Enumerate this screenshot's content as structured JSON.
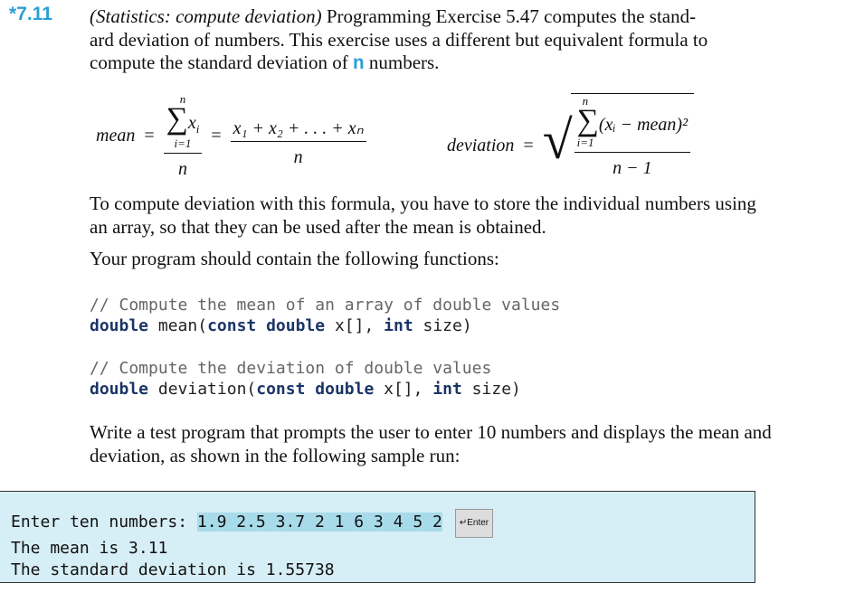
{
  "exercise": {
    "number": "*7.11",
    "title": "(Statistics: compute deviation)",
    "intro_1": " Programming Exercise 5.47 computes the stand-",
    "intro_2": "ard deviation of numbers. This exercise uses a different but equivalent formula to",
    "intro_3a": "compute the standard deviation of ",
    "intro_var": "n",
    "intro_3b": " numbers."
  },
  "formula": {
    "mean_label": "mean",
    "eq": "=",
    "sum_top": "n",
    "sum_sub": "i=1",
    "sum_term": "x",
    "sub_i": "i",
    "denominator": "n",
    "expanded": "x₁ + x₂ +  . . .  + xₙ",
    "deviation_label": "deviation",
    "dev_term": "(xᵢ − mean)²",
    "dev_denominator": "n − 1"
  },
  "para1": "To compute deviation with this formula, you have to store the individual numbers using an array, so that they can be used after the mean is obtained.",
  "para2": "Your program should contain the following functions:",
  "code": {
    "c1": "// Compute the mean of an array of double values",
    "f1_kw1": "double",
    "f1_a": " mean(",
    "f1_kw2": "const double",
    "f1_b": " x[], ",
    "f1_kw3": "int",
    "f1_c": " size)",
    "c2": "// Compute the deviation of double values",
    "f2_kw1": "double",
    "f2_a": " deviation(",
    "f2_kw2": "const double",
    "f2_b": " x[], ",
    "f2_kw3": "int",
    "f2_c": " size)"
  },
  "para3": "Write a test program that prompts the user to enter 10 numbers and displays the mean and deviation, as shown in the following sample run:",
  "sample_run": {
    "prompt": "Enter ten numbers: ",
    "input": "1.9 2.5 3.7 2 1 6 3 4 5 2",
    "enter_key": "↵Enter",
    "line2": "The mean is 3.11",
    "line3": "The standard deviation is 1.55738"
  },
  "colors": {
    "accent": "#2a9fd6",
    "run_bg": "#d6eef6",
    "input_highlight": "#a8dbea"
  }
}
